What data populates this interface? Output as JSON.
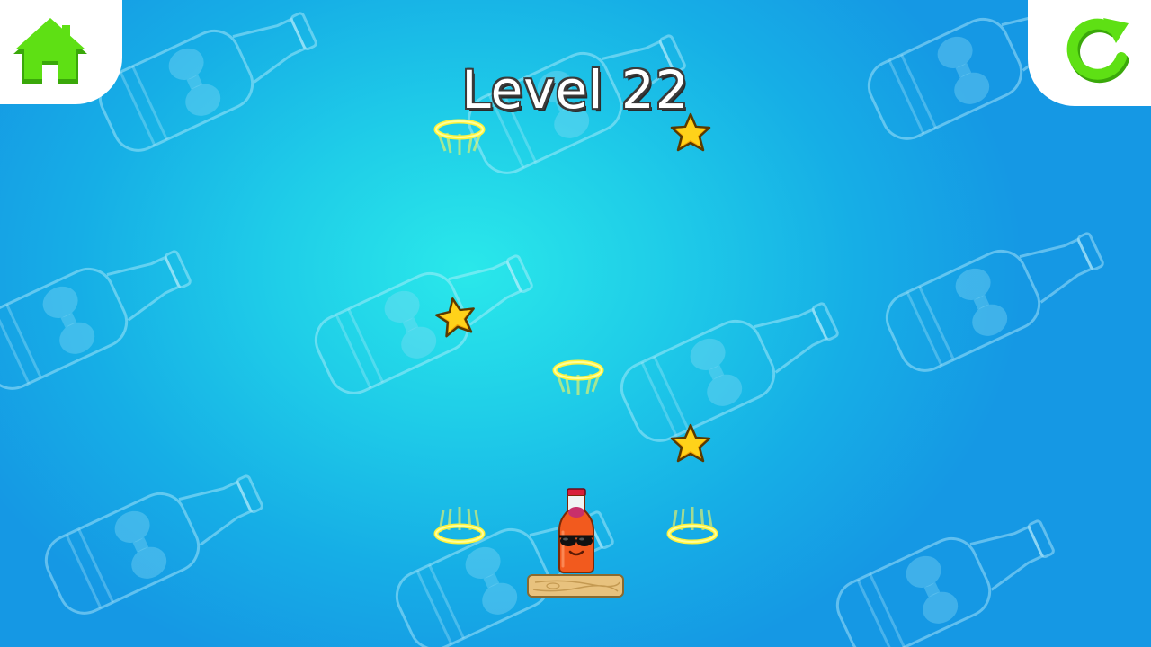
{
  "header": {
    "level_label": "Level 22"
  },
  "buttons": {
    "home_icon": "home-icon",
    "restart_icon": "restart-icon"
  },
  "objects": {
    "stars_count": 3,
    "hoops_count": 4,
    "player": "bottle-with-sunglasses",
    "platform": "wooden-plank"
  },
  "colors": {
    "accent_green": "#4fd80a",
    "star_gold": "#ffd21a",
    "hoop_yellow": "#fff23a",
    "bottle_orange": "#f25a1e",
    "background_center": "#2ae8ea",
    "background_edge": "#1598e4"
  }
}
